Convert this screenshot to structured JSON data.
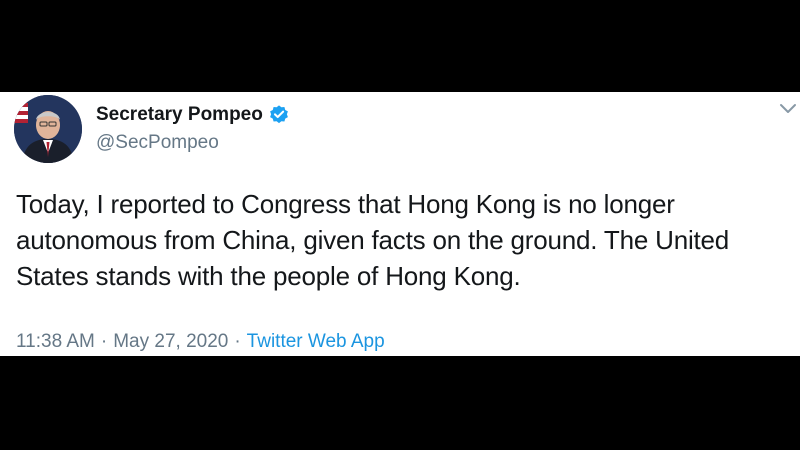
{
  "tweet": {
    "display_name": "Secretary Pompeo",
    "handle": "@SecPompeo",
    "verified": true,
    "text": "Today, I reported to Congress that Hong Kong is no longer autonomous from China, given facts on the ground. The United States stands with the people of Hong Kong.",
    "time": "11:38 AM",
    "separator": "·",
    "date": "May 27, 2020",
    "source": "Twitter Web App"
  },
  "icons": {
    "verified": "verified-badge-icon",
    "menu": "chevron-down-icon"
  },
  "colors": {
    "background": "#000000",
    "card": "#ffffff",
    "name_text": "#14171a",
    "secondary_text": "#657786",
    "link": "#1b95e0",
    "verified_badge": "#1da1f2"
  }
}
